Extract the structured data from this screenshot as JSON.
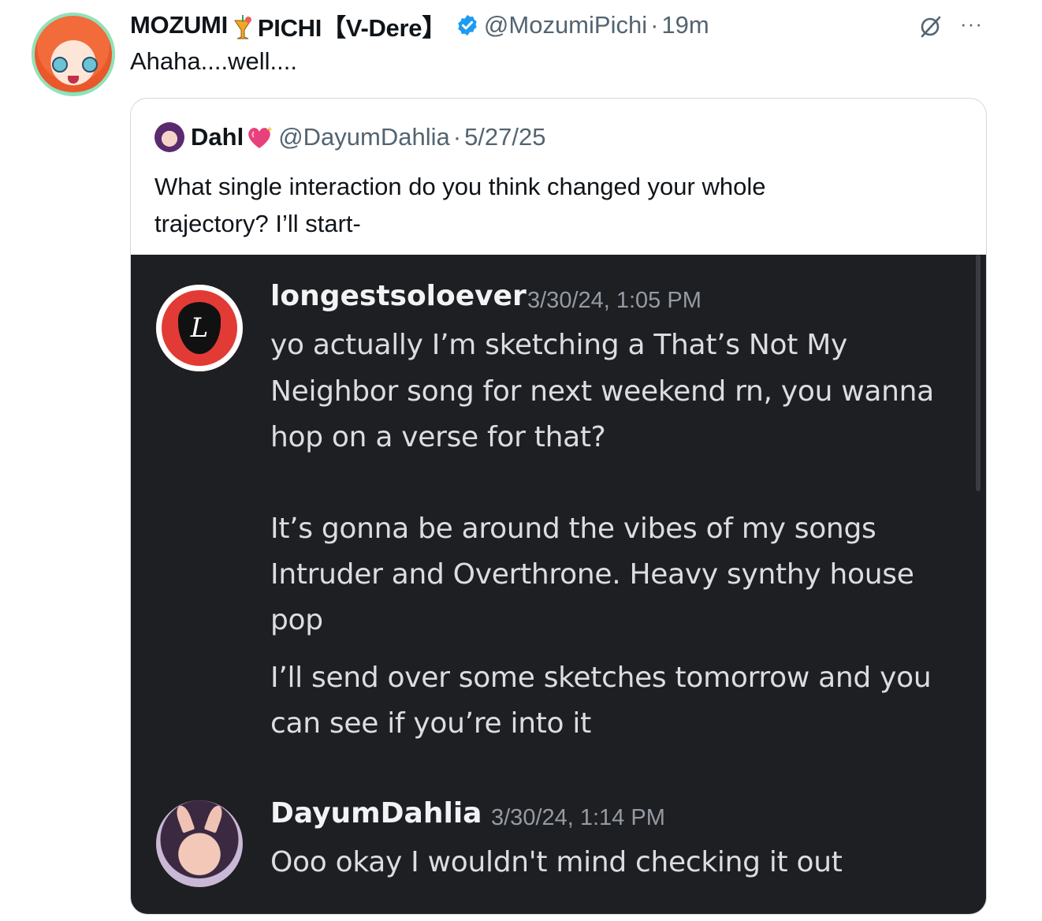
{
  "tweet": {
    "display_name_part1": "MOZUMI",
    "display_name_part2": "PICHI【V-Dere】",
    "handle": "@MozumiPichi",
    "separator": "·",
    "time": "19m",
    "text": "Ahaha....well....",
    "icons": [
      "tropical-drink-icon",
      "verified-badge-icon",
      "repeat-off-icon",
      "more-icon"
    ]
  },
  "quote": {
    "name": "Dahl",
    "handle": "@DayumDahlia",
    "separator": "·",
    "date": "5/27/25",
    "text_line1": "What single interaction do you think changed your whole",
    "text_line2": "trajectory? I’ll start-",
    "icons": [
      "sparkling-heart-icon"
    ]
  },
  "screenshot": {
    "background": "#1e1f22",
    "messages": [
      {
        "username": "longestsoloever",
        "timestamp": "3/30/24, 1:05 PM",
        "lines": [
          "yo actually I’m sketching a That’s Not My",
          "Neighbor song for next weekend rn, you wanna",
          "hop on a verse for that?",
          "It’s gonna be around the vibes of my songs",
          "Intruder and Overthrone. Heavy synthy house",
          "pop",
          "I’ll send over some sketches tomorrow and you",
          "can see if you’re into it"
        ]
      },
      {
        "username": "DayumDahlia",
        "timestamp": "3/30/24, 1:14 PM",
        "lines": [
          "Ooo okay I wouldn't mind checking it out"
        ]
      }
    ]
  },
  "colors": {
    "verified": "#1d9bf0",
    "muted": "#536471",
    "discord_text": "#dbdee1",
    "discord_stamp": "#949ba4"
  }
}
